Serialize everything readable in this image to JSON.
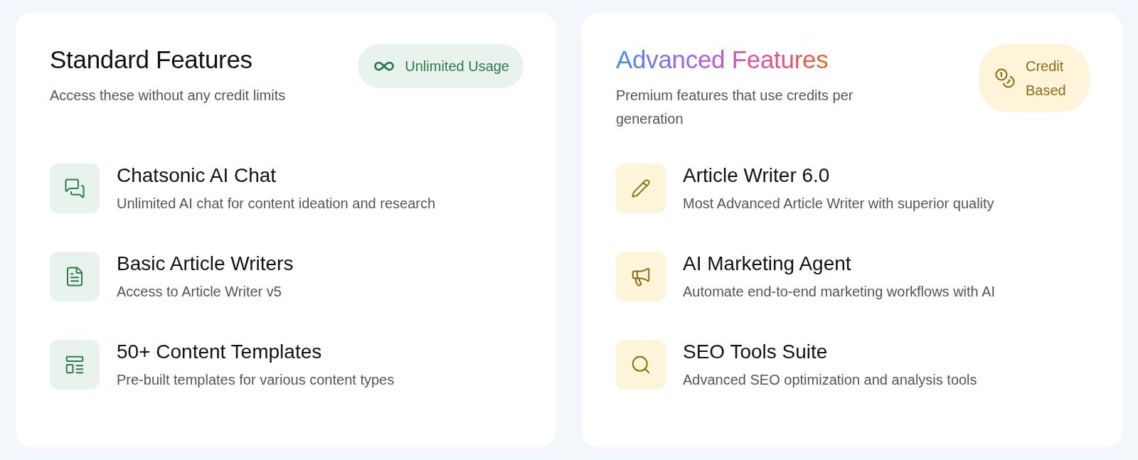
{
  "panels": [
    {
      "kind": "standard",
      "title": "Standard Features",
      "subtitle": "Access these without any credit limits",
      "badge": {
        "label": "Unlimited Usage"
      },
      "items": [
        {
          "title": "Chatsonic AI Chat",
          "description": "Unlimited AI chat for content ideation and research"
        },
        {
          "title": "Basic Article Writers",
          "description": "Access to Article Writer v5"
        },
        {
          "title": "50+ Content Templates",
          "description": "Pre-built templates for various content types"
        }
      ]
    },
    {
      "kind": "advanced",
      "title": "Advanced Features",
      "subtitle": "Premium features that use credits per generation",
      "badge": {
        "label": "Credit Based"
      },
      "items": [
        {
          "title": "Article Writer 6.0",
          "description": "Most Advanced Article Writer with superior quality"
        },
        {
          "title": "AI Marketing Agent",
          "description": "Automate end-to-end marketing workflows with AI"
        },
        {
          "title": "SEO Tools Suite",
          "description": "Advanced SEO optimization and analysis tools"
        }
      ]
    }
  ]
}
